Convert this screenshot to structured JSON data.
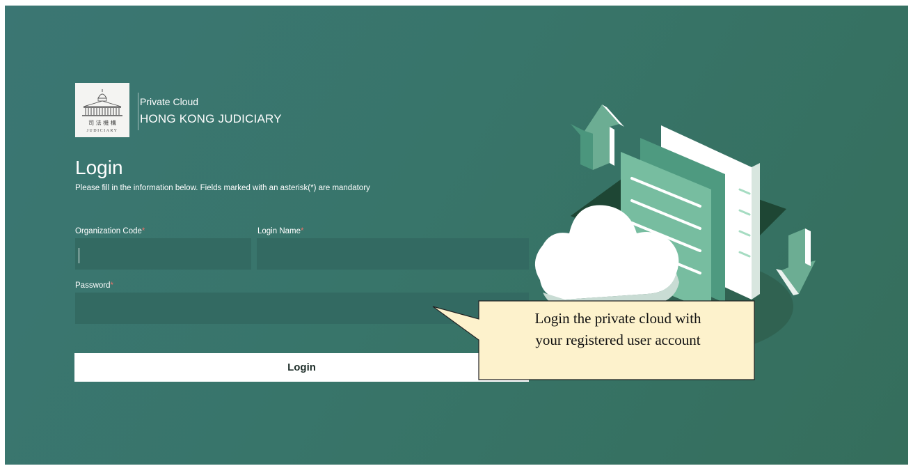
{
  "brand": {
    "subtitle": "Private Cloud",
    "title": "HONG KONG JUDICIARY",
    "logo_chinese": "司 法 機 構",
    "logo_english": "JUDICIARY"
  },
  "login": {
    "title": "Login",
    "description": "Please fill in the information below. Fields marked with an asterisk(*) are mandatory"
  },
  "fields": {
    "org_code": {
      "label": "Organization Code",
      "required_mark": "*",
      "value": ""
    },
    "login_name": {
      "label": "Login Name",
      "required_mark": "*",
      "value": ""
    },
    "password": {
      "label": "Password",
      "required_mark": "*",
      "value": ""
    }
  },
  "submit_label": "Login",
  "callout": {
    "line1": "Login the private cloud with",
    "line2": "your registered user account"
  },
  "colors": {
    "background": "#38756a",
    "input": "#336a62",
    "required": "#e8736a",
    "callout": "#fdf2cc"
  },
  "icons": {
    "illustration": "cloud-documents-illustration",
    "arrow_up": "arrow-up-icon",
    "arrow_down": "arrow-down-icon"
  }
}
